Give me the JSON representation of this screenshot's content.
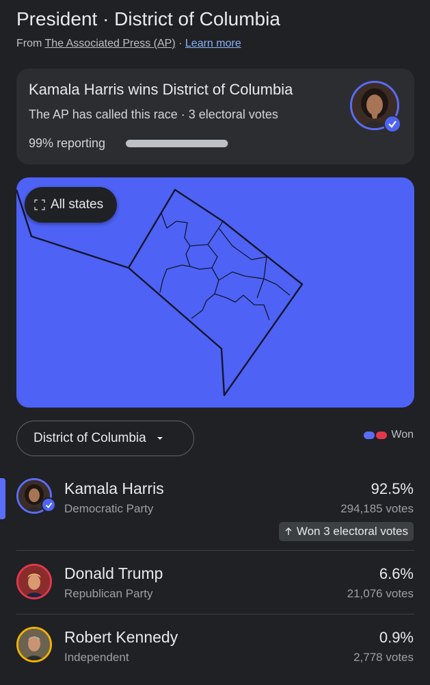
{
  "header": {
    "title": "President · District of Columbia",
    "source_prefix": "From",
    "source_name": "The Associated Press (AP)",
    "separator": "·",
    "learn_more": "Learn more"
  },
  "summary": {
    "headline": "Kamala Harris wins District of Columbia",
    "subline": "The AP has called this race · 3 electoral votes",
    "reporting": "99% reporting",
    "reporting_fraction": 0.99
  },
  "map": {
    "all_states_label": "All states",
    "fill_color": "#4e62f5"
  },
  "selector": {
    "label": "District of Columbia"
  },
  "legend": {
    "label": "Won",
    "colors": [
      "#5b6cf9",
      "#e2384d"
    ]
  },
  "candidates": [
    {
      "name": "Kamala Harris",
      "party": "Democratic Party",
      "percent": "92.5%",
      "votes": "294,185 votes",
      "color": "#5b6cf9",
      "winner": true,
      "won_label": "Won 3 electoral votes"
    },
    {
      "name": "Donald Trump",
      "party": "Republican Party",
      "percent": "6.6%",
      "votes": "21,076 votes",
      "color": "#e2384d"
    },
    {
      "name": "Robert Kennedy",
      "party": "Independent",
      "percent": "0.9%",
      "votes": "2,778 votes",
      "color": "#f2b300"
    }
  ]
}
